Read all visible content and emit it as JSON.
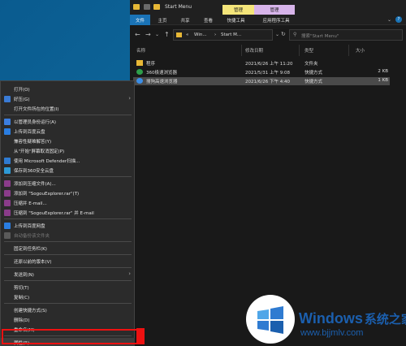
{
  "explorer": {
    "title": "Start Menu",
    "context_tabs": [
      {
        "name": "manage-tab-1",
        "label": "管理",
        "color": "#f4e57a"
      },
      {
        "name": "manage-tab-2",
        "label": "管理",
        "color": "#d7b4ea"
      }
    ],
    "ribbon_tabs": [
      "文件",
      "主页",
      "共享",
      "查看",
      "快捷工具",
      "应用程序工具"
    ],
    "address": {
      "overflow": "«",
      "seg1": "Win...",
      "sep": "›",
      "seg2": "Start M...",
      "chevron": "⌄",
      "refresh": "↻"
    },
    "search_placeholder": "搜索\"Start Menu\"",
    "columns": {
      "name": "名称",
      "date": "修改日期",
      "type": "类型",
      "size": "大小"
    },
    "files": [
      {
        "name": "程序",
        "date": "2021/6/26 上午 11:20",
        "type": "文件夹",
        "size": "",
        "icon": "folder-icon",
        "color": "#e8b836"
      },
      {
        "name": "360极速浏览器",
        "date": "2021/5/31 上午 9:08",
        "type": "快捷方式",
        "size": "2 KB",
        "icon": "browser-360-icon",
        "color": "#2e9e4a"
      },
      {
        "name": "搜狗高速浏览器",
        "date": "2021/6/26 下午 4:40",
        "type": "快捷方式",
        "size": "1 KB",
        "icon": "sogou-browser-icon",
        "color": "#3b8ee6"
      }
    ]
  },
  "menu": {
    "items": [
      {
        "id": "open",
        "label": "打开(O)",
        "icon": "",
        "arrow": false,
        "disabled": false
      },
      {
        "id": "favorite",
        "label": "好压(G)",
        "icon": "haozip-icon",
        "icon_color": "#3a7bd5",
        "arrow": true,
        "disabled": false
      },
      {
        "id": "open-location",
        "label": "打开文件所在的位置(I)",
        "icon": "",
        "arrow": false,
        "disabled": false
      },
      {
        "sep": true
      },
      {
        "id": "run-admin",
        "label": "以管理员身份运行(A)",
        "icon": "shield-icon",
        "icon_color": "#3c7ee0",
        "arrow": false,
        "disabled": false
      },
      {
        "id": "upload-baidu",
        "label": "上传到百度云盘",
        "icon": "cloud-icon",
        "icon_color": "#2a7de1",
        "arrow": false,
        "disabled": false
      },
      {
        "id": "compat",
        "label": "兼容性疑难解答(Y)",
        "icon": "",
        "arrow": false,
        "disabled": false
      },
      {
        "id": "unpin-start",
        "label": "从\"开始\"屏幕取消固定(P)",
        "icon": "",
        "arrow": false,
        "disabled": false
      },
      {
        "id": "defender",
        "label": "使用 Microsoft Defender扫描...",
        "icon": "defender-icon",
        "icon_color": "#2f7bd1",
        "arrow": false,
        "disabled": false
      },
      {
        "id": "protect-360",
        "label": "保存到360安全云盘",
        "icon": "cloud-360-icon",
        "icon_color": "#2e9ad6",
        "arrow": false,
        "disabled": false
      },
      {
        "sep": true
      },
      {
        "id": "add-archive",
        "label": "添加到压缩文件(A)...",
        "icon": "rar-icon",
        "icon_color": "#8a3c8a",
        "arrow": false,
        "disabled": false
      },
      {
        "id": "add-rar",
        "label": "添加到 \"SogouExplorer.rar\"(T)",
        "icon": "rar-icon",
        "icon_color": "#8a3c8a",
        "arrow": false,
        "disabled": false
      },
      {
        "id": "compress-email",
        "label": "压缩并 E-mail...",
        "icon": "rar-icon",
        "icon_color": "#8a3c8a",
        "arrow": false,
        "disabled": false
      },
      {
        "id": "compress-rar-email",
        "label": "压缩到 \"SogouExplorer.rar\" 并 E-mail",
        "icon": "rar-icon",
        "icon_color": "#8a3c8a",
        "arrow": false,
        "disabled": false
      },
      {
        "sep": true
      },
      {
        "id": "upload-baidu-2",
        "label": "上传到百度网盘",
        "icon": "baidu-cloud-icon",
        "icon_color": "#2a7de1",
        "arrow": false,
        "disabled": false
      },
      {
        "id": "auto-backup",
        "label": "自动备份该文件夹",
        "icon": "backup-icon",
        "icon_color": "#5a5a5a",
        "arrow": false,
        "disabled": true
      },
      {
        "sep": true
      },
      {
        "id": "pin-taskbar",
        "label": "固定到任务栏(K)",
        "icon": "",
        "arrow": false,
        "disabled": false
      },
      {
        "sep": true
      },
      {
        "id": "restore",
        "label": "还原以前的版本(V)",
        "icon": "",
        "arrow": false,
        "disabled": false
      },
      {
        "sep": true
      },
      {
        "id": "send-to",
        "label": "发送到(N)",
        "icon": "",
        "arrow": true,
        "disabled": false
      },
      {
        "sep": true
      },
      {
        "id": "cut",
        "label": "剪切(T)",
        "icon": "",
        "arrow": false,
        "disabled": false
      },
      {
        "id": "copy",
        "label": "复制(C)",
        "icon": "",
        "arrow": false,
        "disabled": false
      },
      {
        "sep": true
      },
      {
        "id": "create-shortcut",
        "label": "创建快捷方式(S)",
        "icon": "",
        "arrow": false,
        "disabled": false
      },
      {
        "id": "delete",
        "label": "删除(D)",
        "icon": "",
        "arrow": false,
        "disabled": false
      },
      {
        "id": "rename",
        "label": "重命名(M)",
        "icon": "",
        "arrow": false,
        "disabled": false
      },
      {
        "sep": true
      },
      {
        "id": "properties",
        "label": "属性(R)",
        "icon": "",
        "arrow": false,
        "disabled": false,
        "highlight": true
      }
    ]
  },
  "watermark": {
    "brand": "Windows",
    "brand_cn": "系统之家",
    "url": "www.bjjmlv.com"
  },
  "colors": {
    "accent": "#1a73b6",
    "highlight_box": "#ee1111"
  }
}
